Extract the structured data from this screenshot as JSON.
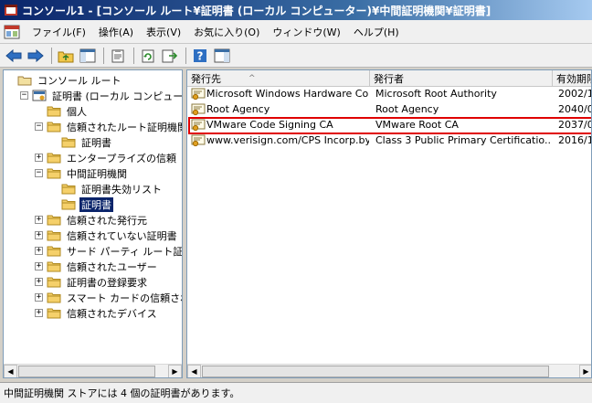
{
  "window": {
    "title": "コンソール1 - [コンソール ルート¥証明書 (ローカル コンピューター)¥中間証明機関¥証明書]"
  },
  "menu": [
    "ファイル(F)",
    "操作(A)",
    "表示(V)",
    "お気に入り(O)",
    "ウィンドウ(W)",
    "ヘルプ(H)"
  ],
  "tree": [
    {
      "label": "コンソール ルート",
      "indent": 0,
      "expander": "",
      "selected": false
    },
    {
      "label": "証明書 (ローカル コンピューター)",
      "indent": 1,
      "expander": "−",
      "selected": false
    },
    {
      "label": "個人",
      "indent": 2,
      "expander": "",
      "selected": false
    },
    {
      "label": "信頼されたルート証明機関",
      "indent": 2,
      "expander": "−",
      "selected": false
    },
    {
      "label": "証明書",
      "indent": 3,
      "expander": "",
      "selected": false
    },
    {
      "label": "エンタープライズの信頼",
      "indent": 2,
      "expander": "+",
      "selected": false
    },
    {
      "label": "中間証明機関",
      "indent": 2,
      "expander": "−",
      "selected": false
    },
    {
      "label": "証明書失効リスト",
      "indent": 3,
      "expander": "",
      "selected": false
    },
    {
      "label": "証明書",
      "indent": 3,
      "expander": "",
      "selected": true
    },
    {
      "label": "信頼された発行元",
      "indent": 2,
      "expander": "+",
      "selected": false
    },
    {
      "label": "信頼されていない証明書",
      "indent": 2,
      "expander": "+",
      "selected": false
    },
    {
      "label": "サード パーティ ルート証明機関",
      "indent": 2,
      "expander": "+",
      "selected": false
    },
    {
      "label": "信頼されたユーザー",
      "indent": 2,
      "expander": "+",
      "selected": false
    },
    {
      "label": "証明書の登録要求",
      "indent": 2,
      "expander": "+",
      "selected": false
    },
    {
      "label": "スマート カードの信頼されたルート",
      "indent": 2,
      "expander": "+",
      "selected": false
    },
    {
      "label": "信頼されたデバイス",
      "indent": 2,
      "expander": "+",
      "selected": false
    }
  ],
  "columns": [
    "発行先",
    "発行者",
    "有効期限"
  ],
  "sort_indicator": "^",
  "rows": [
    {
      "issued_to": "Microsoft Windows Hardware Co...",
      "issued_by": "Microsoft Root Authority",
      "expires": "2002/1"
    },
    {
      "issued_to": "Root Agency",
      "issued_by": "Root Agency",
      "expires": "2040/0"
    },
    {
      "issued_to": "VMware Code Signing CA",
      "issued_by": "VMware Root CA",
      "expires": "2037/0"
    },
    {
      "issued_to": "www.verisign.com/CPS Incorp.by ...",
      "issued_by": "Class 3 Public Primary Certificatio...",
      "expires": "2016/1"
    }
  ],
  "highlighted_row": 2,
  "status": "中間証明機関 ストアには 4 個の証明書があります。",
  "colors": {
    "highlight": "#e00000",
    "selection": "#0a246a"
  }
}
